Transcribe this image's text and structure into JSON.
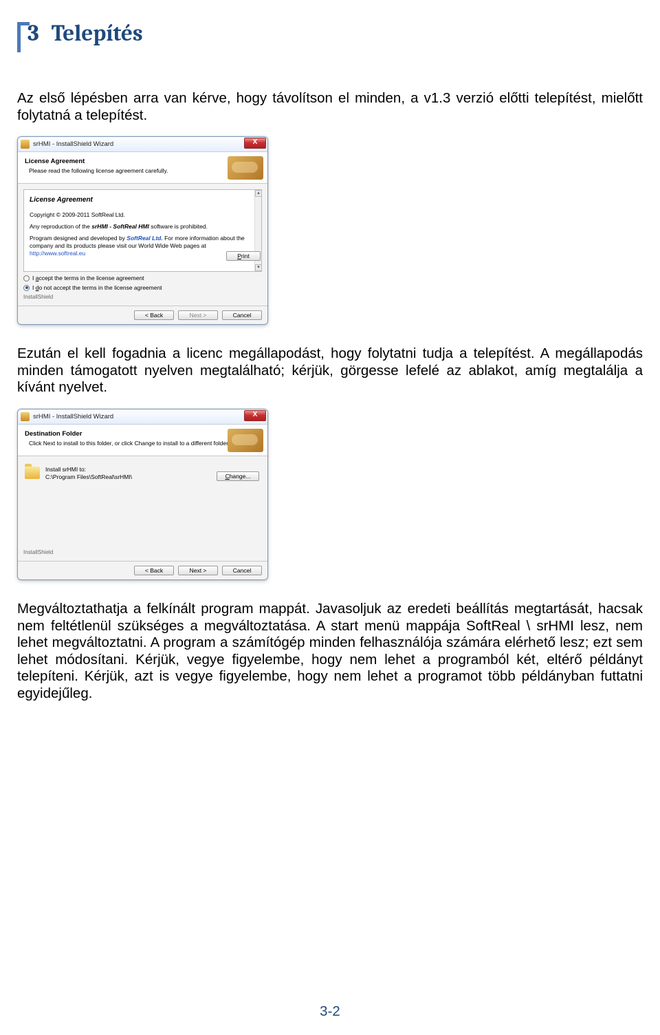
{
  "chapter": {
    "number": "3",
    "title": "Telepítés"
  },
  "para1": "Az első lépésben arra van kérve, hogy távolítson el minden, a v1.3 verzió előtti telepítést, mielőtt folytatná a telepítést.",
  "para2": "Ezután el kell fogadnia a licenc megállapodást, hogy folytatni tudja a telepítést. A megállapodás minden támogatott nyelven megtalálható; kérjük, görgesse lefelé az ablakot, amíg megtalálja a kívánt nyelvet.",
  "para3": "Megváltoztathatja a felkínált program mappát. Javasoljuk az eredeti beállítás megtartását, hacsak nem feltétlenül szükséges a megváltoztatása. A start menü mappája SoftReal \\ srHMI lesz, nem lehet megváltoztatni. A program a számítógép minden felhasználója számára elérhető lesz; ezt sem lehet módosítani. Kérjük, vegye figyelembe, hogy nem lehet a programból két, eltérő példányt telepíteni. Kérjük, azt is vegye figyelembe, hogy nem lehet a programot több példányban futtatni egyidejűleg.",
  "dialog1": {
    "title": "srHMI - InstallShield Wizard",
    "headerTitle": "License Agreement",
    "headerSub": "Please read the following license agreement carefully.",
    "laTitle": "License Agreement",
    "copyright": "Copyright © 2009-2011 SoftReal Ltd.",
    "repro_pre": "Any reproduction of the ",
    "repro_bold": "srHMI - SoftReal HMI",
    "repro_post": " software is prohibited.",
    "design_pre": "Program designed and developed by ",
    "design_bold": "SoftReal Ltd.",
    "design_post": " For more information about the company and its products please visit our World Wide Web pages at ",
    "url": "http://www.softreal.eu",
    "radioAccept": "I accept the terms in the license agreement",
    "radioDecline": "I do not accept the terms in the license agreement",
    "print": "Print",
    "installshield": "InstallShield",
    "back": "< Back",
    "next": "Next >",
    "cancel": "Cancel",
    "closeX": "X"
  },
  "dialog2": {
    "title": "srHMI - InstallShield Wizard",
    "headerTitle": "Destination Folder",
    "headerSub": "Click Next to install to this folder, or click Change to install to a different folder.",
    "installTo": "Install srHMI to:",
    "path": "C:\\Program Files\\SoftReal\\srHMI\\",
    "change": "Change...",
    "installshield": "InstallShield",
    "back": "< Back",
    "next": "Next >",
    "cancel": "Cancel",
    "closeX": "X"
  },
  "pageNumber": "3-2"
}
